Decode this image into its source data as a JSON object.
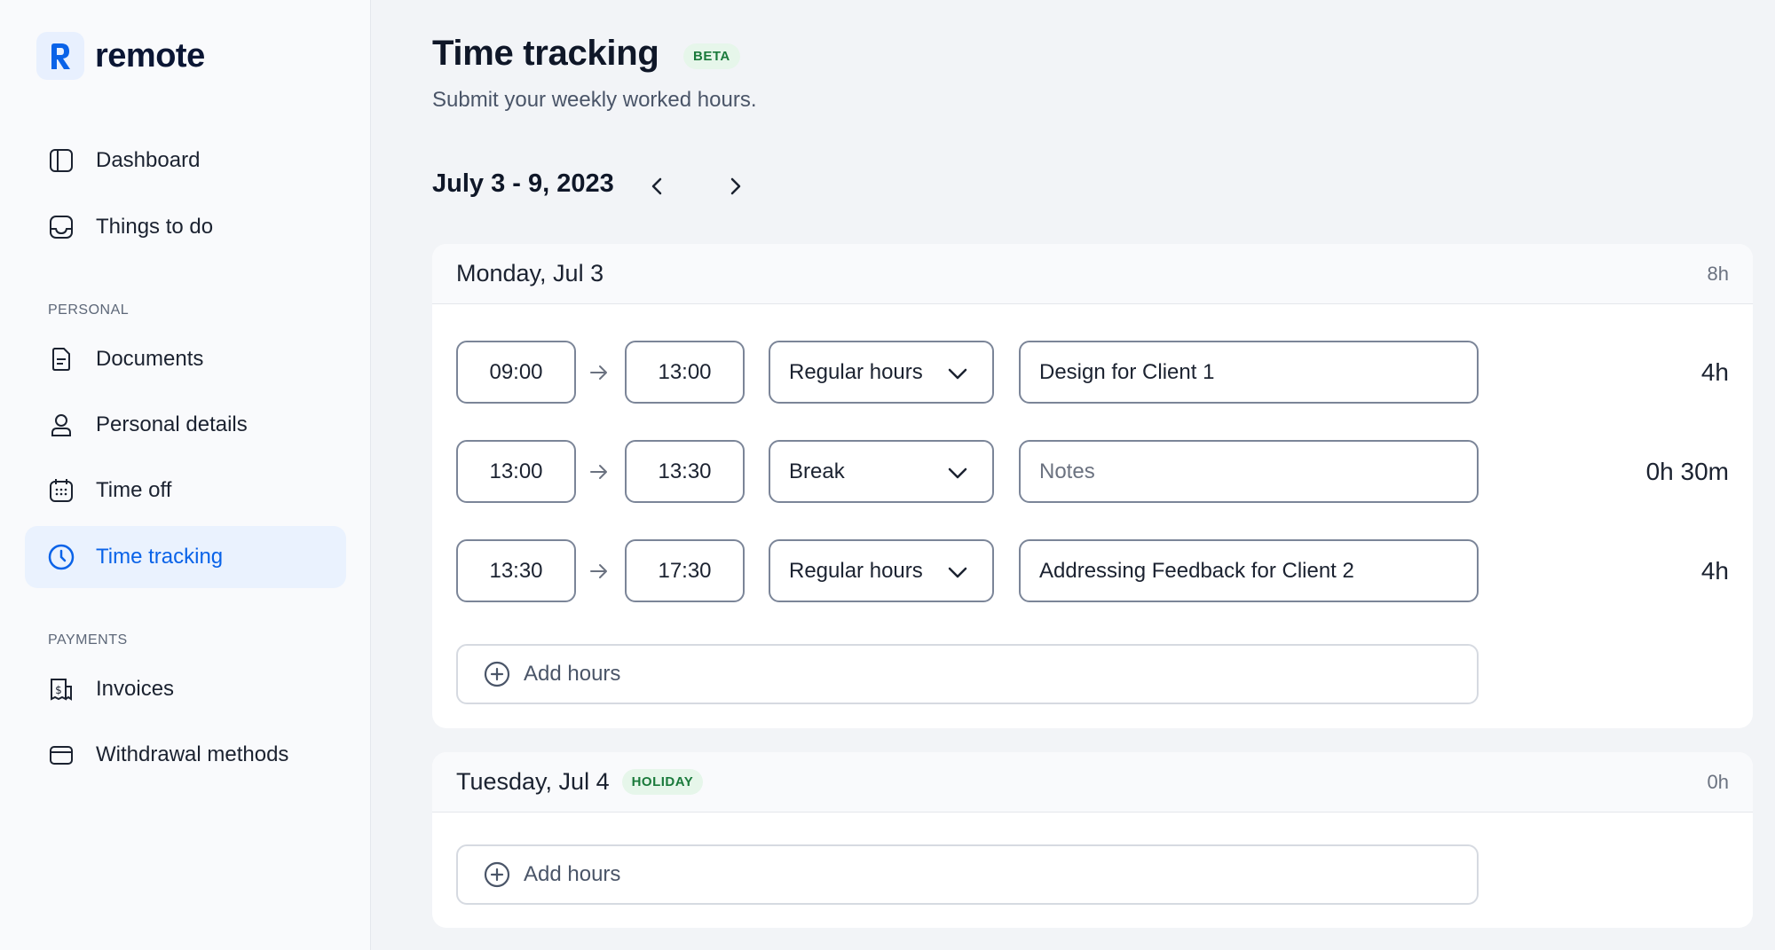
{
  "brand": {
    "name": "remote",
    "accent": "#0a63e8"
  },
  "sidebar": {
    "items_top": [
      {
        "label": "Dashboard",
        "icon": "dashboard-icon"
      },
      {
        "label": "Things to do",
        "icon": "inbox-icon"
      }
    ],
    "section_personal": "PERSONAL",
    "items_personal": [
      {
        "label": "Documents",
        "icon": "document-icon"
      },
      {
        "label": "Personal details",
        "icon": "user-icon"
      },
      {
        "label": "Time off",
        "icon": "calendar-icon"
      },
      {
        "label": "Time tracking",
        "icon": "clock-icon",
        "active": true
      }
    ],
    "section_payments": "PAYMENTS",
    "items_payments": [
      {
        "label": "Invoices",
        "icon": "invoice-icon"
      },
      {
        "label": "Withdrawal methods",
        "icon": "card-icon"
      }
    ]
  },
  "header": {
    "title": "Time tracking",
    "badge": "BETA",
    "subtitle": "Submit your weekly worked hours."
  },
  "week": {
    "range": "July 3 - 9, 2023"
  },
  "days": [
    {
      "title": "Monday, Jul 3",
      "total": "8h",
      "entries": [
        {
          "start": "09:00",
          "end": "13:00",
          "type": "Regular hours",
          "note": "Design for Client 1",
          "duration": "4h"
        },
        {
          "start": "13:00",
          "end": "13:30",
          "type": "Break",
          "note": "",
          "note_placeholder": "Notes",
          "duration": "0h 30m"
        },
        {
          "start": "13:30",
          "end": "17:30",
          "type": "Regular hours",
          "note": "Addressing Feedback for Client 2",
          "duration": "4h"
        }
      ],
      "add_label": "Add hours"
    },
    {
      "title": "Tuesday, Jul 4",
      "badge": "HOLIDAY",
      "total": "0h",
      "add_label": "Add hours"
    }
  ]
}
